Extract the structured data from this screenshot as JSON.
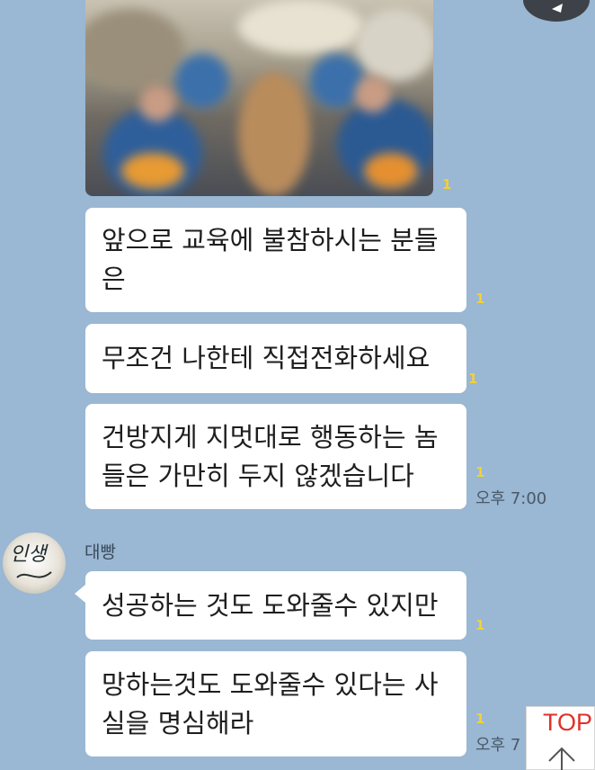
{
  "chat": {
    "messages": [
      {
        "text": "앞으로 교육에 불참하시는 분들\n은",
        "unread": "1"
      },
      {
        "text": "무조건 나한테 직접전화하세요",
        "unread": "1"
      },
      {
        "text": "건방지게 지멋대로 행동하는 놈\n들은 가만히 두지 않겠습니다",
        "unread": "1",
        "time": "오후 7:00"
      }
    ],
    "photo_unread": "1",
    "reply": {
      "sender": "대빵",
      "avatar_text": "인생",
      "messages": [
        {
          "text": "성공하는 것도 도와줄수 있지만",
          "unread": "1"
        },
        {
          "text": "망하는것도 도와줄수 있다는 사\n실을 명심해라",
          "unread": "1",
          "time": "오후 7"
        }
      ]
    }
  },
  "top_button": {
    "label": "TOP",
    "icon": "arrow-up-icon"
  },
  "colors": {
    "background": "#9ab7d3",
    "bubble": "#ffffff",
    "unread": "#f2d03a",
    "top_label": "#e0302a"
  }
}
